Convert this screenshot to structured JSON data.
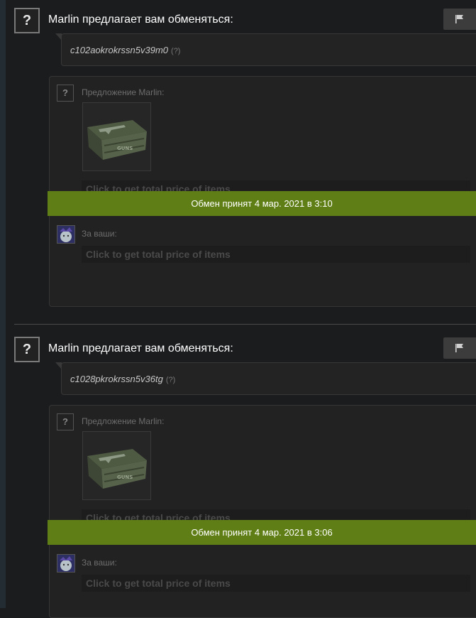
{
  "offers": [
    {
      "title": "Marlin предлагает вам обменяться:",
      "message": "c102aokrokrssn5v39m0",
      "help_mark": "(?)",
      "partner_offer_label": "Предложение Marlin:",
      "price_button": "Click to get total price of items",
      "status": "Обмен принят 4 мар. 2021 в 3:10",
      "your_items_label": "За ваши:",
      "your_price_button": "Click to get total price of items"
    },
    {
      "title": "Marlin предлагает вам обменяться:",
      "message": "c1028pkrokrssn5v36tg",
      "help_mark": "(?)",
      "partner_offer_label": "Предложение Marlin:",
      "price_button": "Click to get total price of items",
      "status": "Обмен принят 4 мар. 2021 в 3:06",
      "your_items_label": "За ваши:",
      "your_price_button": "Click to get total price of items"
    }
  ],
  "icons": {
    "unknown_avatar": "?",
    "report": "flag-icon",
    "item": "weapon-case-icon"
  },
  "colors": {
    "accepted": "#5f7f16",
    "background": "#1b1c1e"
  }
}
